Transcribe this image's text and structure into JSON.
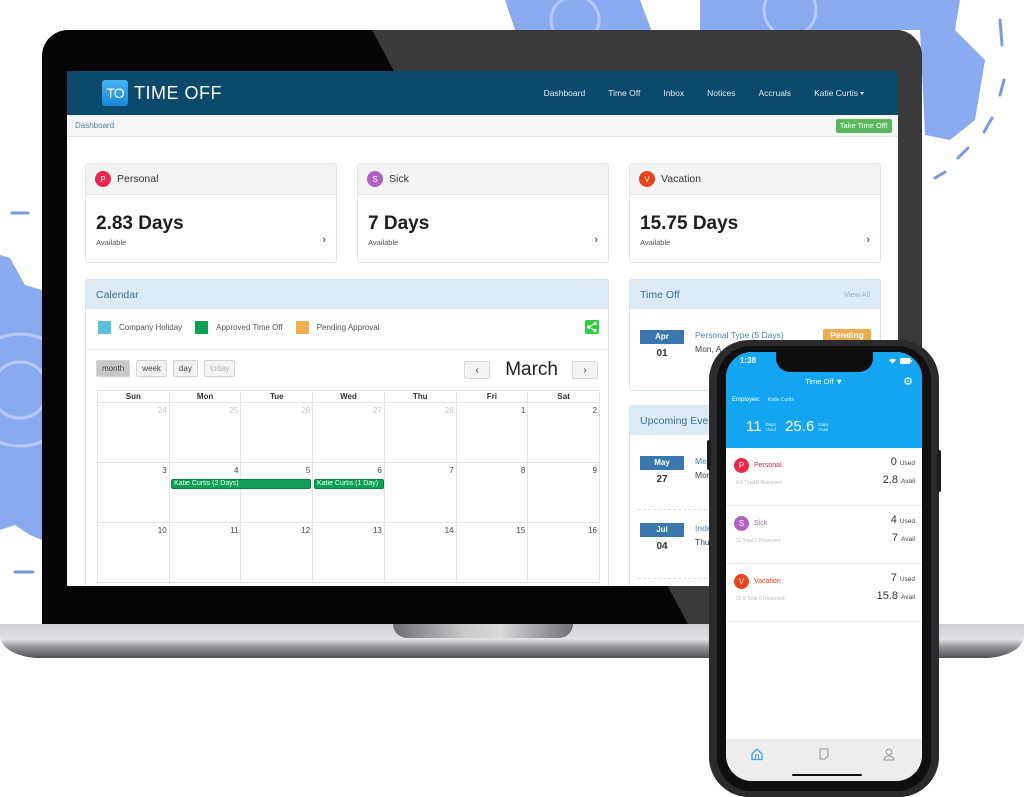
{
  "app": {
    "logo_badge": "TO",
    "logo_text": "TIME OFF"
  },
  "nav": {
    "items": [
      "Dashboard",
      "Time Off",
      "Inbox",
      "Notices",
      "Accruals",
      "Katie Curtis"
    ]
  },
  "breadcrumb": "Dashboard",
  "take_time_off": "Take Time Off!",
  "balances": [
    {
      "letter": "P",
      "title": "Personal",
      "value": "2.83 Days",
      "sub": "Available",
      "color": "#e8274b"
    },
    {
      "letter": "S",
      "title": "Sick",
      "value": "7 Days",
      "sub": "Available",
      "color": "#b35fc4"
    },
    {
      "letter": "V",
      "title": "Vacation",
      "value": "15.75 Days",
      "sub": "Available",
      "color": "#e8451d"
    }
  ],
  "calendar": {
    "title": "Calendar",
    "legend": [
      {
        "label": "Company Holiday",
        "color": "#5bc0de"
      },
      {
        "label": "Approved Time Off",
        "color": "#0fa053"
      },
      {
        "label": "Pending Approval",
        "color": "#f0ad4e"
      }
    ],
    "view_buttons": [
      "month",
      "week",
      "day",
      "today"
    ],
    "month": "March",
    "prev": "‹",
    "next": "›",
    "weekdays": [
      "Sun",
      "Mon",
      "Tue",
      "Wed",
      "Thu",
      "Fri",
      "Sat"
    ],
    "weeks": [
      [
        "24",
        "25",
        "26",
        "27",
        "28",
        "1",
        "2"
      ],
      [
        "3",
        "4",
        "5",
        "6",
        "7",
        "8",
        "9"
      ],
      [
        "10",
        "11",
        "12",
        "13",
        "14",
        "15",
        "16"
      ]
    ],
    "events": [
      {
        "label": "Katie Curtis (2 Days)"
      },
      {
        "label": "Katie Curtis (1 Day)"
      }
    ]
  },
  "time_off_panel": {
    "title": "Time Off",
    "view_all": "View All",
    "items": [
      {
        "month": "Apr",
        "day": "01",
        "title": "Personal Type (5 Days)",
        "sub": "Mon, A",
        "status": "Pending"
      }
    ]
  },
  "upcoming_panel": {
    "title": "Upcoming Eve",
    "items": [
      {
        "month": "May",
        "day": "27",
        "title": "Me",
        "sub": "Mon"
      },
      {
        "month": "Jul",
        "day": "04",
        "title": "Inde",
        "sub": "Thu,"
      }
    ]
  },
  "phone": {
    "time": "1:38",
    "title": "Time Off ▼",
    "employee_label": "Employee:",
    "employee_name": "Katie Curtis",
    "used_value": "11",
    "used_label_1": "Days",
    "used_label_2": "Used",
    "avail_value": "25.6",
    "avail_label_1": "Days",
    "avail_label_2": "Avail",
    "rows": [
      {
        "letter": "P",
        "name": "Personal",
        "meta": "4.5 Total 0 Reserved",
        "used": "0",
        "avail": "2.8",
        "color": "#e8274b"
      },
      {
        "letter": "S",
        "name": "Sick",
        "meta": "11 Total 0 Reserved",
        "used": "4",
        "avail": "7",
        "color": "#b35fc4"
      },
      {
        "letter": "V",
        "name": "Vacation",
        "meta": "22.8 Total 0 Reserved",
        "used": "7",
        "avail": "15.8",
        "color": "#e8451d"
      }
    ],
    "used_unit": "Used",
    "avail_unit": "Avail",
    "tabs": [
      "home-icon",
      "notes-icon",
      "profile-icon"
    ]
  }
}
